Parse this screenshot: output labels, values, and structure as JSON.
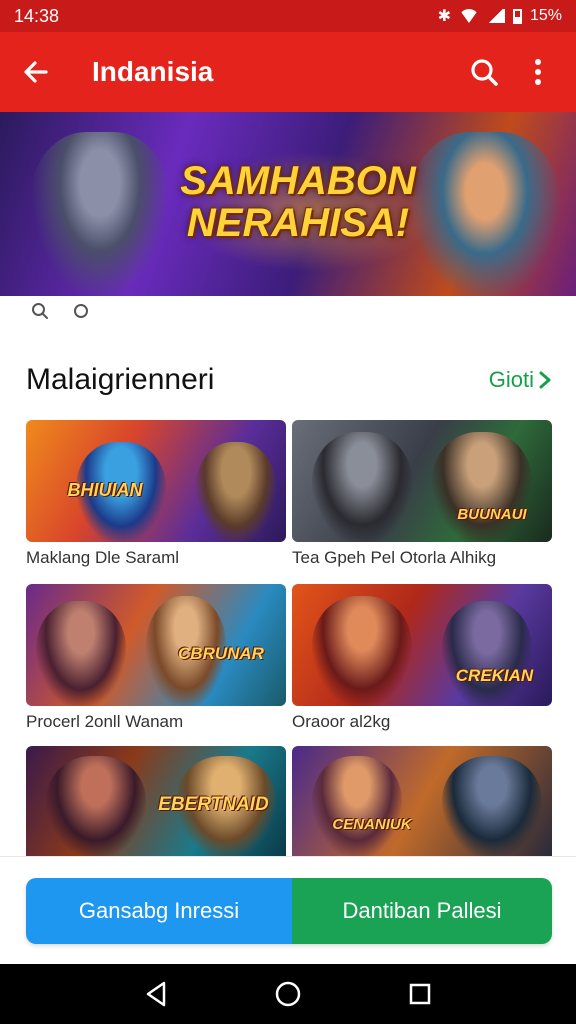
{
  "status_bar": {
    "time": "14:38",
    "battery": "15%"
  },
  "app_bar": {
    "title": "Indanisia"
  },
  "banner": {
    "headline_line1": "SAMHABON",
    "headline_line2": "NERAHISA!"
  },
  "section": {
    "title": "Malaigrienneri",
    "see_all": "Gioti"
  },
  "cards": [
    {
      "label": "Maklang Dle Saraml",
      "art_text": "BHIUIAN"
    },
    {
      "label": "Tea Gpeh Pel Otorla Alhikg",
      "art_text": "BUUNAUI"
    },
    {
      "label": "Procerl 2onll Wanam",
      "art_text": "CBRUNAR"
    },
    {
      "label": "Oraoor al2kg",
      "art_text": "CREKIAN"
    },
    {
      "label": "",
      "art_text": "EBERTNAID"
    },
    {
      "label": "",
      "art_text": "CENANIUK"
    }
  ],
  "buttons": {
    "left": "Gansabg Inressi",
    "right": "Dantiban Pallesi"
  },
  "colors": {
    "status_bar": "#c91a1a",
    "app_bar": "#e3231c",
    "see_all": "#17a04a",
    "btn_left": "#1e97f0",
    "btn_right": "#1aa355"
  }
}
